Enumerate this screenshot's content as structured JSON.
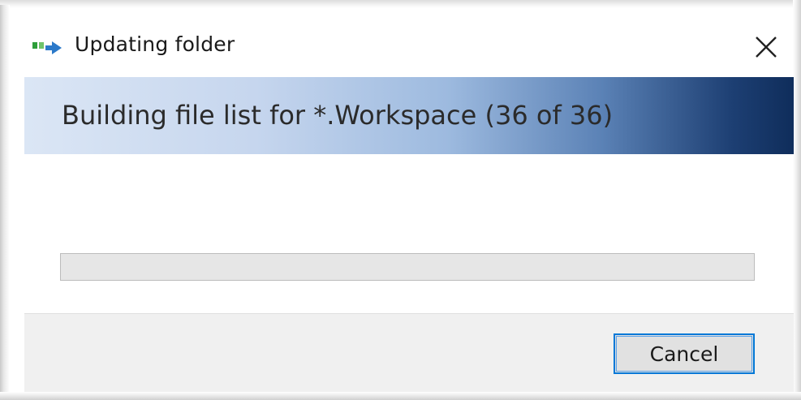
{
  "window": {
    "title": "Updating folder"
  },
  "banner": {
    "status_text": "Building file list for *.Workspace (36 of 36)"
  },
  "progress": {
    "fraction": 0.0
  },
  "footer": {
    "cancel_label": "Cancel"
  },
  "icons": {
    "app": "folder-update-icon",
    "close": "close-icon"
  },
  "colors": {
    "accent": "#0078d7",
    "banner_start": "#dbe6f5",
    "banner_end": "#0f2d5b",
    "progress_fill": "#06b025"
  }
}
